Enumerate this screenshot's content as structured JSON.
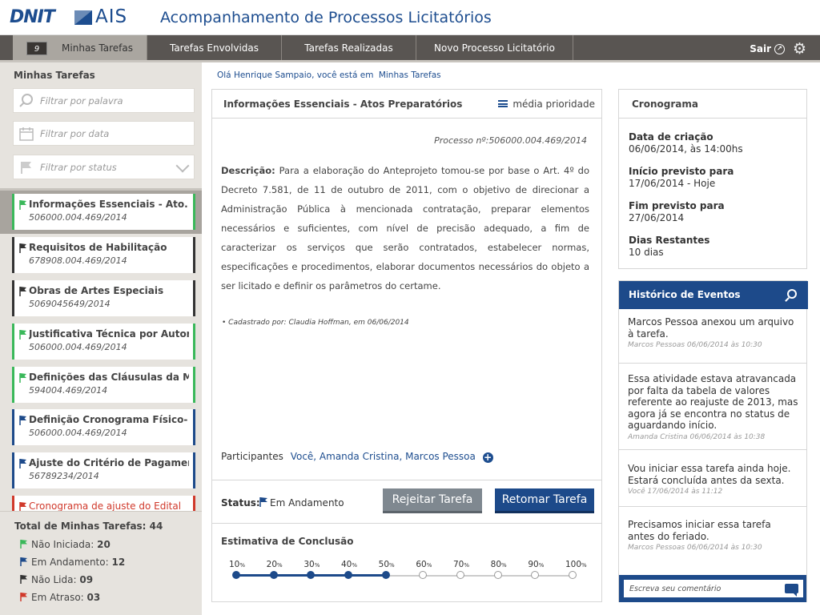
{
  "header": {
    "logo_dnit": "DNIT",
    "logo_ais": "AIS",
    "title": "Acompanhamento de Processos Licitatórios"
  },
  "nav": {
    "count": "9",
    "tabs": [
      {
        "label": "Minhas Tarefas",
        "active": true
      },
      {
        "label": "Tarefas Envolvidas",
        "active": false
      },
      {
        "label": "Tarefas Realizadas",
        "active": false
      },
      {
        "label": "Novo Processo Licitatório",
        "active": false
      }
    ],
    "exit": "Sair"
  },
  "sidebar": {
    "title": "Minhas Tarefas",
    "filters": {
      "word": "Filtrar por palavra",
      "date": "Filtrar por data",
      "status": "Filtrar por status"
    },
    "tasks": [
      {
        "name": "Informações Essenciais - Ato...",
        "num": "506000.004.469/2014",
        "flag": "#3ab85a",
        "border": "#3ab85a"
      },
      {
        "name": "Requisitos de Habilitação",
        "num": "678908.004.469/2014",
        "flag": "#333333",
        "border": "#333333"
      },
      {
        "name": "Obras de Artes Especiais",
        "num": "5069045649/2014",
        "flag": "#333333",
        "border": "#333333"
      },
      {
        "name": "Justificativa Técnica por Autor...",
        "num": "506000.004.469/2014",
        "flag": "#3ab85a",
        "border": "#3ab85a"
      },
      {
        "name": "Definições das Cláusulas da Mi...",
        "num": "594004.469/2014",
        "flag": "#3ab85a",
        "border": "#3ab85a"
      },
      {
        "name": "Definição Cronograma Físico- F...",
        "num": "506000.004.469/2014",
        "flag": "#1d4a8a",
        "border": "#1d4a8a"
      },
      {
        "name": "Ajuste do Critério de Pagamento",
        "num": "56789234/2014",
        "flag": "#1d4a8a",
        "border": "#1d4a8a"
      },
      {
        "name": "Cronograma de ajuste do Edital",
        "num": "",
        "flag": "#d0392b",
        "border": "#d0392b"
      }
    ],
    "totals": {
      "title": "Total de Minhas Tarefas: 44",
      "rows": [
        {
          "label": "Não Iniciada:",
          "value": "20",
          "color": "#3ab85a"
        },
        {
          "label": "Em Andamento:",
          "value": "12",
          "color": "#1d4a8a"
        },
        {
          "label": "Não Lida:",
          "value": "09",
          "color": "#333333"
        },
        {
          "label": "Em Atraso:",
          "value": "03",
          "color": "#d0392b"
        }
      ]
    }
  },
  "breadcrumb": {
    "prefix": "Olá Henrique Sampaio, você está em",
    "current": "Minhas Tarefas"
  },
  "main": {
    "title": "Informações Essenciais - Atos Preparatórios",
    "priority": "média prioridade",
    "process_number": "Processo nº:506000.004.469/2014",
    "description_label": "Descrição:",
    "description": "Para a elaboração do Anteprojeto tomou-se por base o Art. 4º do Decreto 7.581, de 11 de outubro de 2011, com o objetivo de direcionar a Administração Pública à mencionada contratação, preparar elementos necessários e suficientes, com nível de precisão adequado, a fim de caracterizar os serviços que serão contratados, estabelecer normas, especificações e procedimentos, elaborar documentos necessários do objeto a ser licitado e definir os parâmetros do certame.",
    "created_by": "• Cadastrado por: Claudia Hoffman, em 06/06/2014",
    "participants_label": "Participantes",
    "participants": "Você, Amanda Cristina, Marcos Pessoa",
    "status_label": "Status:",
    "status_value": "Em Andamento",
    "reject_button": "Rejeitar Tarefa",
    "resume_button": "Retomar Tarefa",
    "estimate_title": "Estimativa de Conclusão",
    "estimate_steps": [
      "10",
      "20",
      "30",
      "40",
      "50",
      "60",
      "70",
      "80",
      "90",
      "100"
    ],
    "estimate_unit": "%",
    "estimate_progress": 50
  },
  "cronograma": {
    "title": "Cronograma",
    "items": [
      {
        "label": "Data de criação",
        "value": "06/06/2014, às 14:00hs"
      },
      {
        "label": "Início previsto para",
        "value": "17/06/2014 - Hoje"
      },
      {
        "label": "Fim previsto para",
        "value": "27/06/2014"
      },
      {
        "label": "Dias Restantes",
        "value": "10 dias"
      }
    ]
  },
  "historico": {
    "title": "Histórico de Eventos",
    "events": [
      {
        "text": "Marcos Pessoa anexou um arquivo à tarefa.",
        "meta": "Marcos Pessoas 06/06/2014 às 10:30"
      },
      {
        "text": "Essa atividade estava atravancada por falta da tabela de valores referente ao reajuste de 2013, mas agora já se encontra no status de aguardando início.",
        "meta": "Amanda Cristina 06/06/2014 às 10:38"
      },
      {
        "text": "Vou iniciar essa tarefa ainda hoje. Estará concluída antes da sexta.",
        "meta": "Você 17/06/2014 às 11:12"
      },
      {
        "text": "Precisamos iniciar essa tarefa antes do feriado.",
        "meta": "Marcos Pessoas 06/06/2014 às 10:30"
      }
    ],
    "comment_placeholder": "Escreva seu comentário"
  }
}
